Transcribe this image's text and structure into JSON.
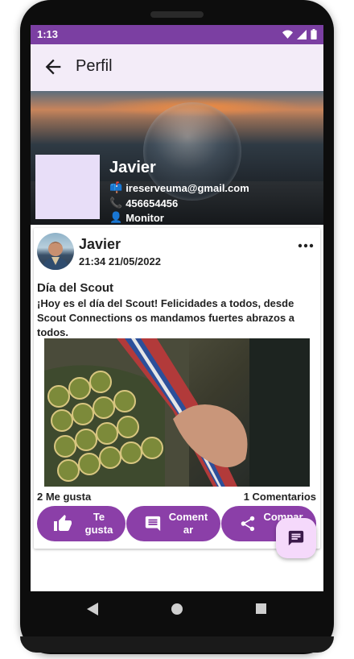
{
  "status_bar": {
    "time": "1:13"
  },
  "app_bar": {
    "title": "Perfil"
  },
  "profile": {
    "name": "Javier",
    "email": "ireserveuma@gmail.com",
    "phone": "456654456",
    "role": "Monitor"
  },
  "post": {
    "author": "Javier",
    "date": "21:34 21/05/2022",
    "title": "Día del Scout",
    "body": "¡Hoy es el día del Scout! Felicidades a todos, desde Scout Connections os mandamos fuertes abrazos a todos.",
    "likes_text": "2 Me gusta",
    "comments_text": "1 Comentarios",
    "actions": {
      "like": "Te gusta",
      "comment": "Comentar",
      "share": "Compartir"
    }
  },
  "colors": {
    "accent": "#8b3fa8",
    "status_bar": "#7b3fa2",
    "app_bar": "#f3ecf8",
    "fab": "#f5d9fb"
  }
}
